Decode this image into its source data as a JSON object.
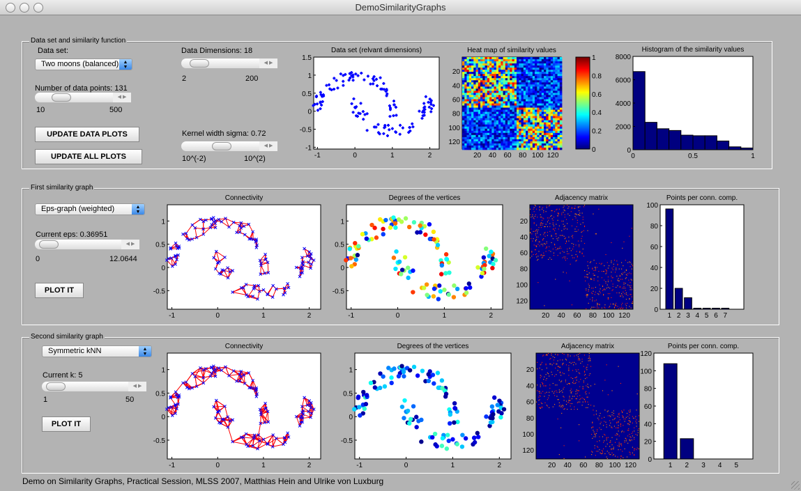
{
  "window": {
    "title": "DemoSimilarityGraphs"
  },
  "panel1": {
    "label": "Data set and similarity function",
    "dataset_label": "Data set:",
    "dataset_value": "Two moons (balanced)",
    "npoints_label": "Number of data points: 131",
    "npoints": {
      "min": "10",
      "max": "500",
      "value": 131
    },
    "dims_label": "Data Dimensions: 18",
    "dims": {
      "min": "2",
      "max": "200",
      "value": 18
    },
    "sigma_label": "Kernel width sigma: 0.72",
    "sigma": {
      "min": "10^(-2)",
      "max": "10^(2)",
      "value": 0.72
    },
    "update_data_btn": "UPDATE DATA PLOTS",
    "update_all_btn": "UPDATE ALL PLOTS"
  },
  "panel2": {
    "label": "First similarity graph",
    "graph_type": "Eps-graph (weighted)",
    "param_label": "Current eps: 0.36951",
    "param": {
      "min": "0",
      "max": "12.0644",
      "value": 0.36951
    },
    "plot_btn": "PLOT IT"
  },
  "panel3": {
    "label": "Second similarity graph",
    "graph_type": "Symmetric kNN",
    "param_label": "Current k: 5",
    "param": {
      "min": "1",
      "max": "50",
      "value": 5
    },
    "plot_btn": "PLOT IT"
  },
  "footer": "Demo on Similarity Graphs, Practical Session, MLSS 2007, Matthias Hein and Ulrike von Luxburg",
  "chart_data": [
    {
      "id": "dataset",
      "type": "scatter",
      "title": "Data set (relvant dimensions)",
      "xlim": [
        -1.1,
        2.25
      ],
      "ylim": [
        -1.05,
        1.5
      ],
      "xticks": [
        -1,
        0,
        1,
        2
      ],
      "yticks": [
        -1,
        -0.5,
        0,
        0.5,
        1,
        1.5
      ],
      "color": "#0000ff",
      "n_points": 131
    },
    {
      "id": "heatmap",
      "type": "heatmap",
      "title": "Heat map of similarity values",
      "xticks": [
        20,
        40,
        60,
        80,
        100,
        120
      ],
      "yticks": [
        20,
        40,
        60,
        80,
        100,
        120
      ],
      "colorbar_ticks": [
        0,
        0.2,
        0.4,
        0.6,
        0.8,
        1
      ],
      "clusters": [
        [
          1,
          70
        ],
        [
          71,
          131
        ]
      ]
    },
    {
      "id": "histogram",
      "type": "bar",
      "title": "Histogram of the similarity values",
      "bin_edges": [
        0,
        0.1,
        0.2,
        0.3,
        0.4,
        0.5,
        0.6,
        0.7,
        0.8,
        0.9,
        1.0
      ],
      "values": [
        6700,
        2350,
        1800,
        1650,
        1250,
        1200,
        1200,
        750,
        250,
        150
      ],
      "xticks": [
        0,
        0.5,
        1
      ],
      "yticks": [
        0,
        2000,
        4000,
        6000,
        8000
      ],
      "ylim": [
        0,
        8000
      ],
      "xlim": [
        0,
        1
      ],
      "color": "#000080"
    },
    {
      "id": "conn1",
      "type": "scatter",
      "title": "Connectivity",
      "graph": "first",
      "xlim": [
        -1.1,
        2.25
      ],
      "ylim": [
        -0.9,
        1.35
      ],
      "xticks": [
        -1,
        0,
        1,
        2
      ],
      "yticks": [
        -0.5,
        0,
        0.5,
        1
      ],
      "edge_color": "#ff0000",
      "node_color": "#0000ff"
    },
    {
      "id": "deg1",
      "type": "scatter",
      "title": "Degrees of the vertices",
      "graph": "first",
      "xlim": [
        -1.1,
        2.25
      ],
      "ylim": [
        -0.9,
        1.35
      ],
      "xticks": [
        -1,
        0,
        1,
        2
      ],
      "yticks": [
        -0.5,
        0,
        0.5,
        1
      ]
    },
    {
      "id": "adj1",
      "type": "heatmap",
      "title": "Adjacency matrix",
      "graph": "first",
      "xticks": [
        20,
        40,
        60,
        80,
        100,
        120
      ],
      "yticks": [
        20,
        40,
        60,
        80,
        100,
        120
      ]
    },
    {
      "id": "cc1",
      "type": "bar",
      "title": "Points per conn. comp.",
      "graph": "first",
      "categories": [
        "1",
        "2",
        "3",
        "4",
        "5",
        "6",
        "7"
      ],
      "values": [
        96,
        20,
        11,
        1,
        1,
        1,
        1
      ],
      "ylim": [
        0,
        100
      ],
      "yticks": [
        0,
        20,
        40,
        60,
        80,
        100
      ],
      "xlim": [
        0,
        9
      ],
      "color": "#000080"
    },
    {
      "id": "conn2",
      "type": "scatter",
      "title": "Connectivity",
      "graph": "second",
      "xlim": [
        -1.1,
        2.25
      ],
      "ylim": [
        -0.9,
        1.35
      ],
      "xticks": [
        -1,
        0,
        1,
        2
      ],
      "yticks": [
        -0.5,
        0,
        0.5,
        1
      ],
      "edge_color": "#ff0000",
      "node_color": "#0000ff"
    },
    {
      "id": "deg2",
      "type": "scatter",
      "title": "Degrees of the vertices",
      "graph": "second",
      "xlim": [
        -1.1,
        2.25
      ],
      "ylim": [
        -0.9,
        1.35
      ],
      "xticks": [
        -1,
        0,
        1,
        2
      ],
      "yticks": [
        -0.5,
        0,
        0.5,
        1
      ]
    },
    {
      "id": "adj2",
      "type": "heatmap",
      "title": "Adjacency matrix",
      "graph": "second",
      "xticks": [
        20,
        40,
        60,
        80,
        100,
        120
      ],
      "yticks": [
        20,
        40,
        60,
        80,
        100,
        120
      ]
    },
    {
      "id": "cc2",
      "type": "bar",
      "title": "Points per conn. comp.",
      "graph": "second",
      "categories": [
        "1",
        "2",
        "3",
        "4",
        "5"
      ],
      "values": [
        108,
        23,
        0,
        0,
        0
      ],
      "ylim": [
        0,
        120
      ],
      "yticks": [
        0,
        20,
        40,
        60,
        80,
        100,
        120
      ],
      "xlim": [
        0,
        6
      ],
      "color": "#000080"
    }
  ]
}
